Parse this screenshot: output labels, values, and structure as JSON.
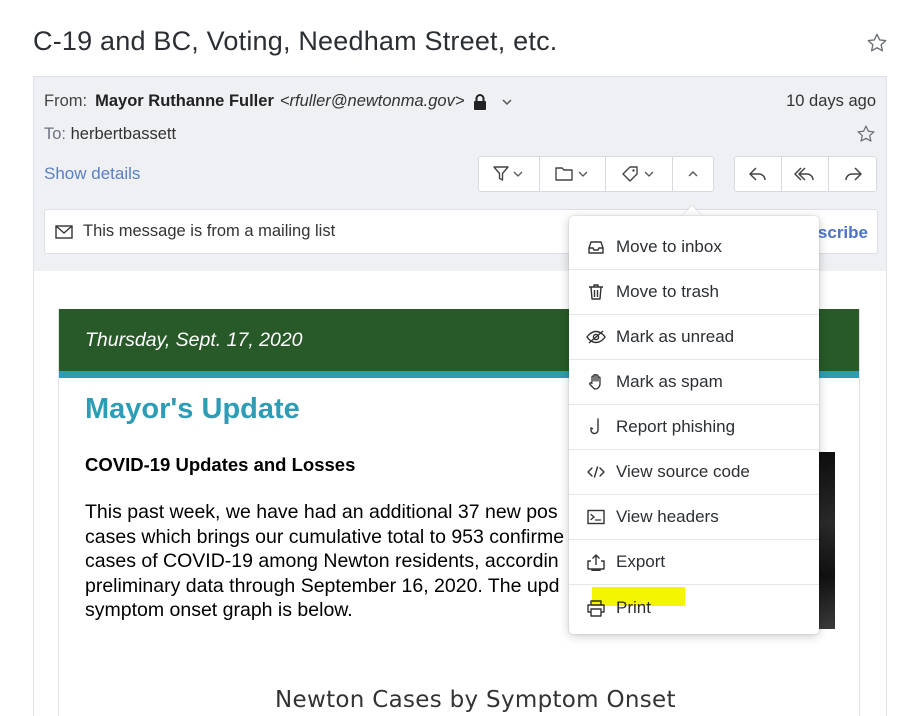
{
  "subject": "C-19 and BC, Voting, Needham Street, etc.",
  "header": {
    "from_label": "From:",
    "from_name": "Mayor Ruthanne Fuller",
    "from_address": "<rfuller@newtonma.gov>",
    "date": "10 days ago",
    "to_label": "To:",
    "to_value": "herbertbassett",
    "show_details": "Show details"
  },
  "toolbar": {
    "icons": [
      "filter-icon",
      "folder-icon",
      "tag-icon",
      "chevron-up-icon",
      "reply-icon",
      "reply-all-icon",
      "forward-icon"
    ]
  },
  "mailing_list": {
    "message": "This message is from a mailing list",
    "unsubscribe_partial": "scribe"
  },
  "email_body": {
    "banner_date": "Thursday, Sept. 17, 2020",
    "title": "Mayor's Update",
    "section_heading": "COVID-19 Updates and Losses",
    "paragraph_lines": [
      "This past week, we have had an additional 37 new pos",
      "cases which brings our cumulative total to 953 confirme",
      "cases of COVID-19 among Newton residents, accordin",
      "preliminary data through September 16, 2020. The upd",
      "symptom onset graph is below."
    ],
    "graph_title": "Newton Cases by Symptom Onset"
  },
  "menu": {
    "items": [
      {
        "label": "Move to inbox",
        "icon": "inbox-icon"
      },
      {
        "label": "Move to trash",
        "icon": "trash-icon"
      },
      {
        "label": "Mark as unread",
        "icon": "eye-slash-icon"
      },
      {
        "label": "Mark as spam",
        "icon": "hand-stop-icon"
      },
      {
        "label": "Report phishing",
        "icon": "hook-icon"
      },
      {
        "label": "View source code",
        "icon": "code-icon"
      },
      {
        "label": "View headers",
        "icon": "terminal-icon"
      },
      {
        "label": "Export",
        "icon": "export-icon"
      },
      {
        "label": "Print",
        "icon": "printer-icon"
      }
    ]
  },
  "colors": {
    "banner_green": "#275a28",
    "accent_teal": "#2d9cb5",
    "link_blue": "#5a7fc2",
    "highlight_yellow": "#f4f500"
  }
}
